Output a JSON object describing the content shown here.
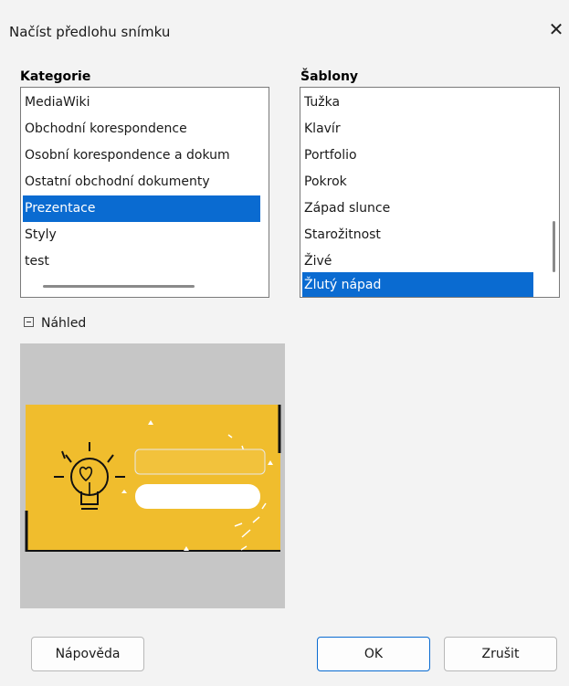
{
  "window": {
    "title": "Načíst předlohu snímku",
    "close_label": "✕"
  },
  "categories": {
    "label": "Kategorie",
    "items": [
      "MediaWiki",
      "Obchodní korespondence",
      "Osobní korespondence a dokum",
      "Ostatní obchodní dokumenty",
      "Prezentace",
      "Styly",
      "test"
    ],
    "selected": "Prezentace"
  },
  "templates": {
    "label": "Šablony",
    "items": [
      "Tužka",
      "Klavír",
      "Portfolio",
      "Pokrok",
      "Západ slunce",
      "Starožitnost",
      "Živé",
      "Žlutý nápad"
    ],
    "selected": "Žlutý nápad"
  },
  "preview": {
    "label": "Náhled",
    "expanded": true,
    "slide_color": "#f0bd2d",
    "bg_color": "#c6c6c6"
  },
  "buttons": {
    "help": "Nápověda",
    "ok": "OK",
    "cancel": "Zrušit"
  },
  "colors": {
    "selection": "#0a6bd1",
    "dialog_bg": "#f3f3f3"
  }
}
